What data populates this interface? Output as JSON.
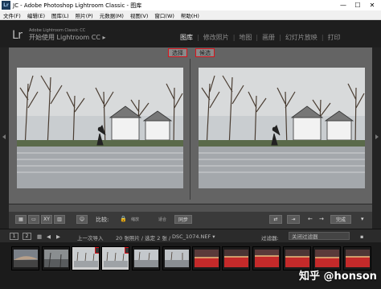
{
  "window": {
    "title": "JC - Adobe Photoshop Lightroom Classic - 图库",
    "app_icon_label": "Lr",
    "controls": {
      "minimize": "—",
      "maximize": "☐",
      "close": "✕"
    }
  },
  "menu": [
    "文件(F)",
    "编辑(E)",
    "图库(L)",
    "照片(P)",
    "元数据(M)",
    "视图(V)",
    "窗口(W)",
    "帮助(H)"
  ],
  "identity": {
    "logo": "Lr",
    "product_small": "Adobe Lightroom Classic CC",
    "tagline": "开始使用 Lightroom CC ▸"
  },
  "modules": [
    {
      "label": "图库",
      "active": true
    },
    {
      "label": "修改照片",
      "active": false
    },
    {
      "label": "地图",
      "active": false
    },
    {
      "label": "画册",
      "active": false
    },
    {
      "label": "幻灯片放映",
      "active": false
    },
    {
      "label": "打印",
      "active": false
    }
  ],
  "compare": {
    "select_label": "选择",
    "candidate_label": "候选"
  },
  "toolbar": {
    "compare_label": "比较:",
    "zoom_label": "缩放",
    "zoom_value": "适合",
    "sync_button": "同步",
    "done_button": "完成"
  },
  "filmbar": {
    "page1": "1",
    "page2": "2",
    "source_text": "上一次导入",
    "count_text": "20 张照片 / 选定 2 张 /",
    "file_name": "DSC_1074.NEF ▾",
    "filter_label": "过滤器:",
    "filter_value": "关闭过滤器"
  },
  "filmstrip": {
    "badge_select": "S",
    "badge_candidate": "C"
  },
  "watermark": "知乎 @honson",
  "colors": {
    "highlight_red": "#d8141c",
    "accent_red": "#c42a2a"
  }
}
